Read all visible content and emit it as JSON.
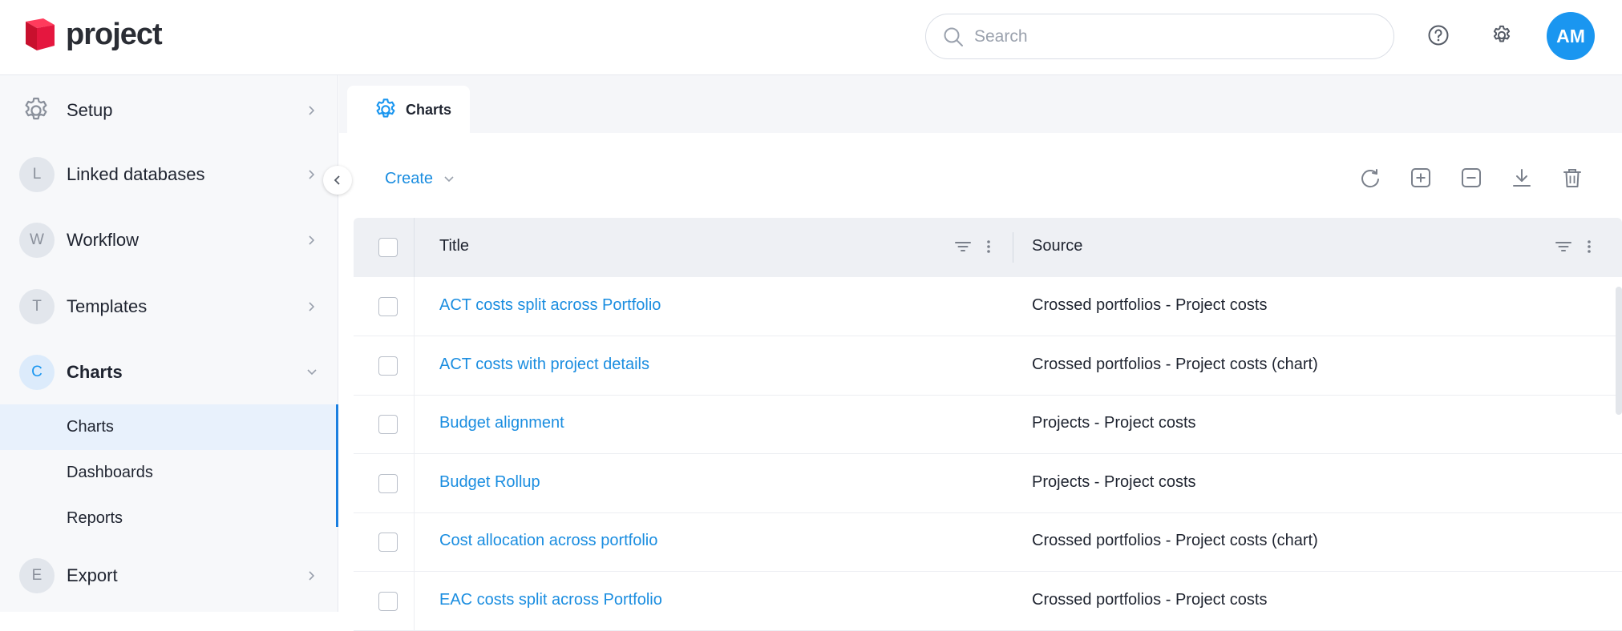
{
  "app": {
    "logo_text": "project"
  },
  "search": {
    "placeholder": "Search"
  },
  "header": {
    "avatar_initials": "AM"
  },
  "sidebar": {
    "items": [
      {
        "label": "Setup",
        "badge": ""
      },
      {
        "label": "Linked databases",
        "badge": "L"
      },
      {
        "label": "Workflow",
        "badge": "W"
      },
      {
        "label": "Templates",
        "badge": "T"
      },
      {
        "label": "Charts",
        "badge": "C"
      },
      {
        "label": "Export",
        "badge": "E"
      }
    ],
    "subitems": [
      {
        "label": "Charts"
      },
      {
        "label": "Dashboards"
      },
      {
        "label": "Reports"
      }
    ]
  },
  "tab": {
    "label": "Charts"
  },
  "toolbar": {
    "create_label": "Create"
  },
  "table": {
    "columns": [
      "Title",
      "Source"
    ],
    "rows": [
      {
        "title": "ACT costs split across Portfolio",
        "source": "Crossed portfolios - Project costs"
      },
      {
        "title": "ACT costs with project details",
        "source": "Crossed portfolios - Project costs (chart)"
      },
      {
        "title": "Budget alignment",
        "source": "Projects - Project costs"
      },
      {
        "title": "Budget Rollup",
        "source": "Projects - Project costs"
      },
      {
        "title": "Cost allocation across portfolio",
        "source": "Crossed portfolios - Project costs (chart)"
      },
      {
        "title": "EAC costs split across Portfolio",
        "source": "Crossed portfolios - Project costs"
      }
    ]
  },
  "colors": {
    "accent": "#1a96f0",
    "link": "#1a8de0",
    "brand": "#e5173f"
  }
}
